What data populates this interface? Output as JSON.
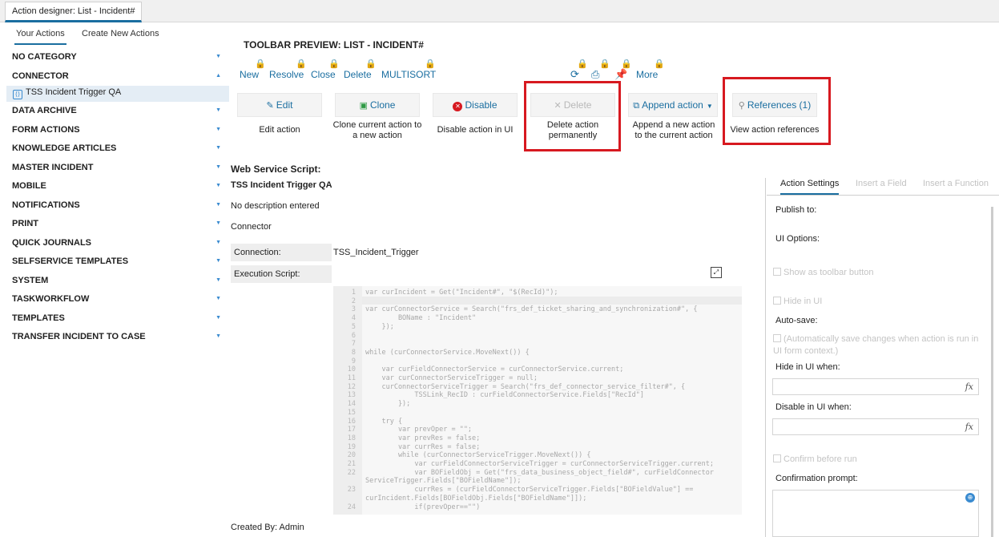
{
  "doc_tab": "Action designer: List - Incident#",
  "left": {
    "tabs": [
      "Your Actions",
      "Create New Actions"
    ],
    "categories": [
      {
        "label": "NO CATEGORY"
      },
      {
        "label": "CONNECTOR",
        "expanded": true,
        "item": "TSS Incident Trigger QA"
      },
      {
        "label": "DATA ARCHIVE"
      },
      {
        "label": "FORM ACTIONS"
      },
      {
        "label": "KNOWLEDGE ARTICLES"
      },
      {
        "label": "MASTER INCIDENT"
      },
      {
        "label": "MOBILE"
      },
      {
        "label": "NOTIFICATIONS"
      },
      {
        "label": "PRINT"
      },
      {
        "label": "QUICK JOURNALS"
      },
      {
        "label": "SELFSERVICE TEMPLATES"
      },
      {
        "label": "SYSTEM"
      },
      {
        "label": "TASKWORKFLOW"
      },
      {
        "label": "TEMPLATES"
      },
      {
        "label": "TRANSFER INCIDENT TO CASE"
      }
    ]
  },
  "toolbar_preview": {
    "title": "TOOLBAR PREVIEW: LIST - INCIDENT#",
    "buttons": [
      "New",
      "Resolve",
      "Close",
      "Delete",
      "MULTISORT"
    ],
    "more": "More",
    "icons": [
      "refresh-icon",
      "print-icon",
      "pin-icon"
    ]
  },
  "actions": [
    {
      "label": "Edit",
      "desc": "Edit action",
      "icon": "pencil-icon"
    },
    {
      "label": "Clone",
      "desc": "Clone current action to a new action",
      "icon": "clone-icon"
    },
    {
      "label": "Disable",
      "desc": "Disable action in UI",
      "icon": "disable-icon"
    },
    {
      "label": "Delete",
      "desc": "Delete action permanently",
      "icon": "close-icon",
      "disabled": true
    },
    {
      "label": "Append action",
      "desc": "Append a new action to the current action",
      "icon": "append-icon"
    },
    {
      "label": "References (1)",
      "desc": "View action references",
      "icon": "search-icon"
    }
  ],
  "script": {
    "type_label": "Web Service Script:",
    "name": "TSS Incident Trigger QA",
    "description": "No description entered",
    "category": "Connector",
    "connection_label": "Connection:",
    "connection_value": "TSS_Incident_Trigger",
    "execution_label": "Execution Script:",
    "code_lines": [
      {
        "n": "1",
        "t": "var curIncident = Get(\"Incident#\", \"$(RecId)\");"
      },
      {
        "n": "2",
        "t": ""
      },
      {
        "n": "3",
        "t": "var curConnectorService = Search(\"frs_def_ticket_sharing_and_synchronization#\", {"
      },
      {
        "n": "4",
        "t": "        BOName : \"Incident\""
      },
      {
        "n": "5",
        "t": "    });"
      },
      {
        "n": "6",
        "t": ""
      },
      {
        "n": "7",
        "t": ""
      },
      {
        "n": "8",
        "t": "while (curConnectorService.MoveNext()) {"
      },
      {
        "n": "9",
        "t": ""
      },
      {
        "n": "10",
        "t": "    var curFieldConnectorService = curConnectorService.current;"
      },
      {
        "n": "11",
        "t": "    var curConnectorServiceTrigger = null;"
      },
      {
        "n": "12",
        "t": "    curConnectorServiceTrigger = Search(\"frs_def_connector_service_filter#\", {"
      },
      {
        "n": "13",
        "t": "            TSSLink_RecID : curFieldConnectorService.Fields[\"RecId\"]"
      },
      {
        "n": "14",
        "t": "        });"
      },
      {
        "n": "15",
        "t": ""
      },
      {
        "n": "16",
        "t": "    try {"
      },
      {
        "n": "17",
        "t": "        var prevOper = \"\";"
      },
      {
        "n": "18",
        "t": "        var prevRes = false;"
      },
      {
        "n": "19",
        "t": "        var currRes = false;"
      },
      {
        "n": "20",
        "t": "        while (curConnectorServiceTrigger.MoveNext()) {"
      },
      {
        "n": "21",
        "t": "            var curFieldConnectorServiceTrigger = curConnectorServiceTrigger.current;"
      },
      {
        "n": "22",
        "t": "            var BOFieldObj = Get(\"frs_data_business_object_field#\", curFieldConnector"
      },
      {
        "n": "",
        "t": "ServiceTrigger.Fields[\"BOFieldName\"]);"
      },
      {
        "n": "23",
        "t": "            currRes = (curFieldConnectorServiceTrigger.Fields[\"BOFieldValue\"] =="
      },
      {
        "n": "",
        "t": "curIncident.Fields[BOFieldObj.Fields[\"BOFieldName\"]]);"
      },
      {
        "n": "24",
        "t": "            if(prevOper==\"\")"
      }
    ],
    "created_by": "Created By: Admin"
  },
  "settings": {
    "tabs": [
      "Action Settings",
      "Insert a Field",
      "Insert a Function"
    ],
    "publish_to": "Publish to:",
    "ui_options": "UI Options:",
    "show_toolbar": "Show as toolbar button",
    "hide_in_ui": "Hide in UI",
    "auto_save": "Auto-save:",
    "auto_save_desc": "(Automatically save changes when action is run in UI form context.)",
    "hide_when": "Hide in UI when:",
    "disable_when": "Disable in UI when:",
    "confirm_before": "Confirm before run",
    "confirm_prompt": "Confirmation prompt:",
    "fx": "fx"
  },
  "colors": {
    "accent": "#1a6ea0",
    "highlight": "#d71920",
    "lock": "#e8a200"
  }
}
